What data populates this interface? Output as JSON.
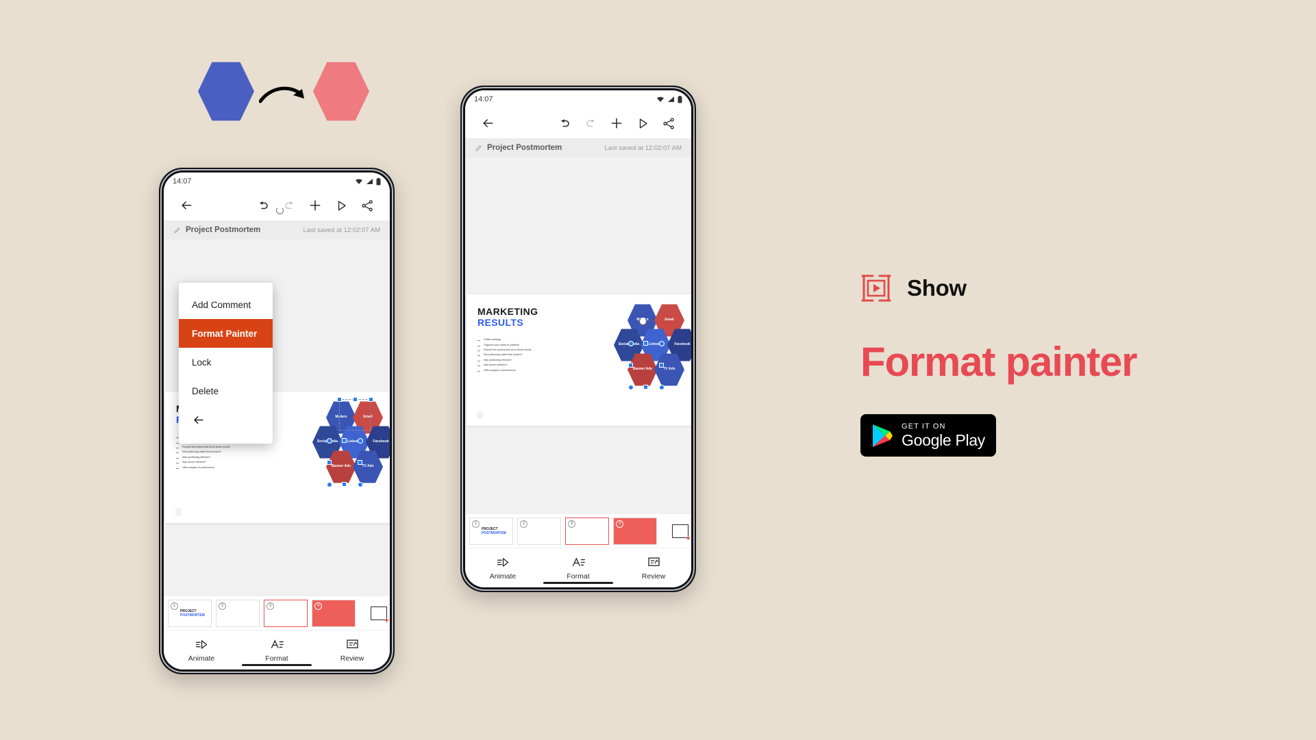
{
  "hero": {
    "left_hex_color": "#4a5fc1",
    "right_hex_color": "#ef7a7f",
    "arrow_icon": "curved-arrow-icon"
  },
  "phone_left": {
    "status": {
      "time": "14:07",
      "wifi_icon": "wifi-icon",
      "signal_icon": "signal-icon",
      "battery_icon": "battery-icon"
    },
    "toolbar": {
      "back_icon": "back-arrow-icon",
      "undo_icon": "undo-icon",
      "redo_icon": "redo-icon",
      "add_icon": "plus-icon",
      "present_icon": "play-icon",
      "share_icon": "share-icon"
    },
    "title_row": {
      "edit_icon": "pencil-icon",
      "title": "Project Postmortem",
      "saved": "Last saved at 12:02:07 AM"
    },
    "context_menu": {
      "items": [
        {
          "label": "Add Comment",
          "highlighted": false
        },
        {
          "label": "Format Painter",
          "highlighted": true
        },
        {
          "label": "Lock",
          "highlighted": false
        },
        {
          "label": "Delete",
          "highlighted": false
        }
      ],
      "back_icon": "back-arrow-icon",
      "highlight_color": "#d84315"
    }
  },
  "phone_right": {
    "status": {
      "time": "14:07",
      "wifi_icon": "wifi-icon",
      "signal_icon": "signal-icon",
      "battery_icon": "battery-icon"
    },
    "toolbar": {
      "back_icon": "back-arrow-icon",
      "undo_icon": "undo-icon",
      "redo_icon": "redo-icon",
      "add_icon": "plus-icon",
      "present_icon": "play-icon",
      "share_icon": "share-icon"
    },
    "title_row": {
      "edit_icon": "pencil-icon",
      "title": "Project Postmortem",
      "saved": "Last saved at 12:02:07 AM"
    }
  },
  "slide": {
    "title_line1": "MARKETING",
    "title_line2": "RESULTS",
    "bullets": [
      "Outline strategy",
      "Organize your points by platform",
      "Pinpoint the actions that led to these results",
      "Did positioning match final product?",
      "Was positioning effective?",
      "Was launch effective?",
      "Offer analysis of performance"
    ],
    "hexagons": [
      {
        "label": "Mailers",
        "color": "#3a55b4"
      },
      {
        "label": "Email",
        "color": "#c94a46"
      },
      {
        "label": "Social Media",
        "color": "#2f4898"
      },
      {
        "label": "LinkedIn",
        "color": "#3f63cf"
      },
      {
        "label": "Facebook",
        "color": "#2b3f8c"
      },
      {
        "label": "Banner Ads",
        "color": "#b8413f"
      },
      {
        "label": "TV Ads",
        "color": "#3a55b4"
      }
    ]
  },
  "thumbnails": [
    {
      "number": "1",
      "title_line1": "PROJECT",
      "title_line2": "POSTMORTEM",
      "selected": false
    },
    {
      "number": "2",
      "title_line1": "",
      "title_line2": "",
      "selected": false
    },
    {
      "number": "3",
      "title_line1": "",
      "title_line2": "",
      "selected": true
    },
    {
      "number": "4",
      "title_line1": "",
      "title_line2": "",
      "selected": false
    }
  ],
  "add_slide": {
    "icon": "add-slide-icon"
  },
  "bottom_nav": [
    {
      "label": "Animate",
      "icon": "animate-icon",
      "active": false
    },
    {
      "label": "Format",
      "icon": "format-icon",
      "active": true
    },
    {
      "label": "Review",
      "icon": "review-icon",
      "active": false
    }
  ],
  "branding": {
    "logo_icon": "show-logo-icon",
    "app_name": "Show",
    "headline": "Format painter",
    "accent_color": "#e74a54",
    "store_badge": {
      "small": "GET IT ON",
      "large": "Google Play",
      "icon": "google-play-icon"
    }
  }
}
